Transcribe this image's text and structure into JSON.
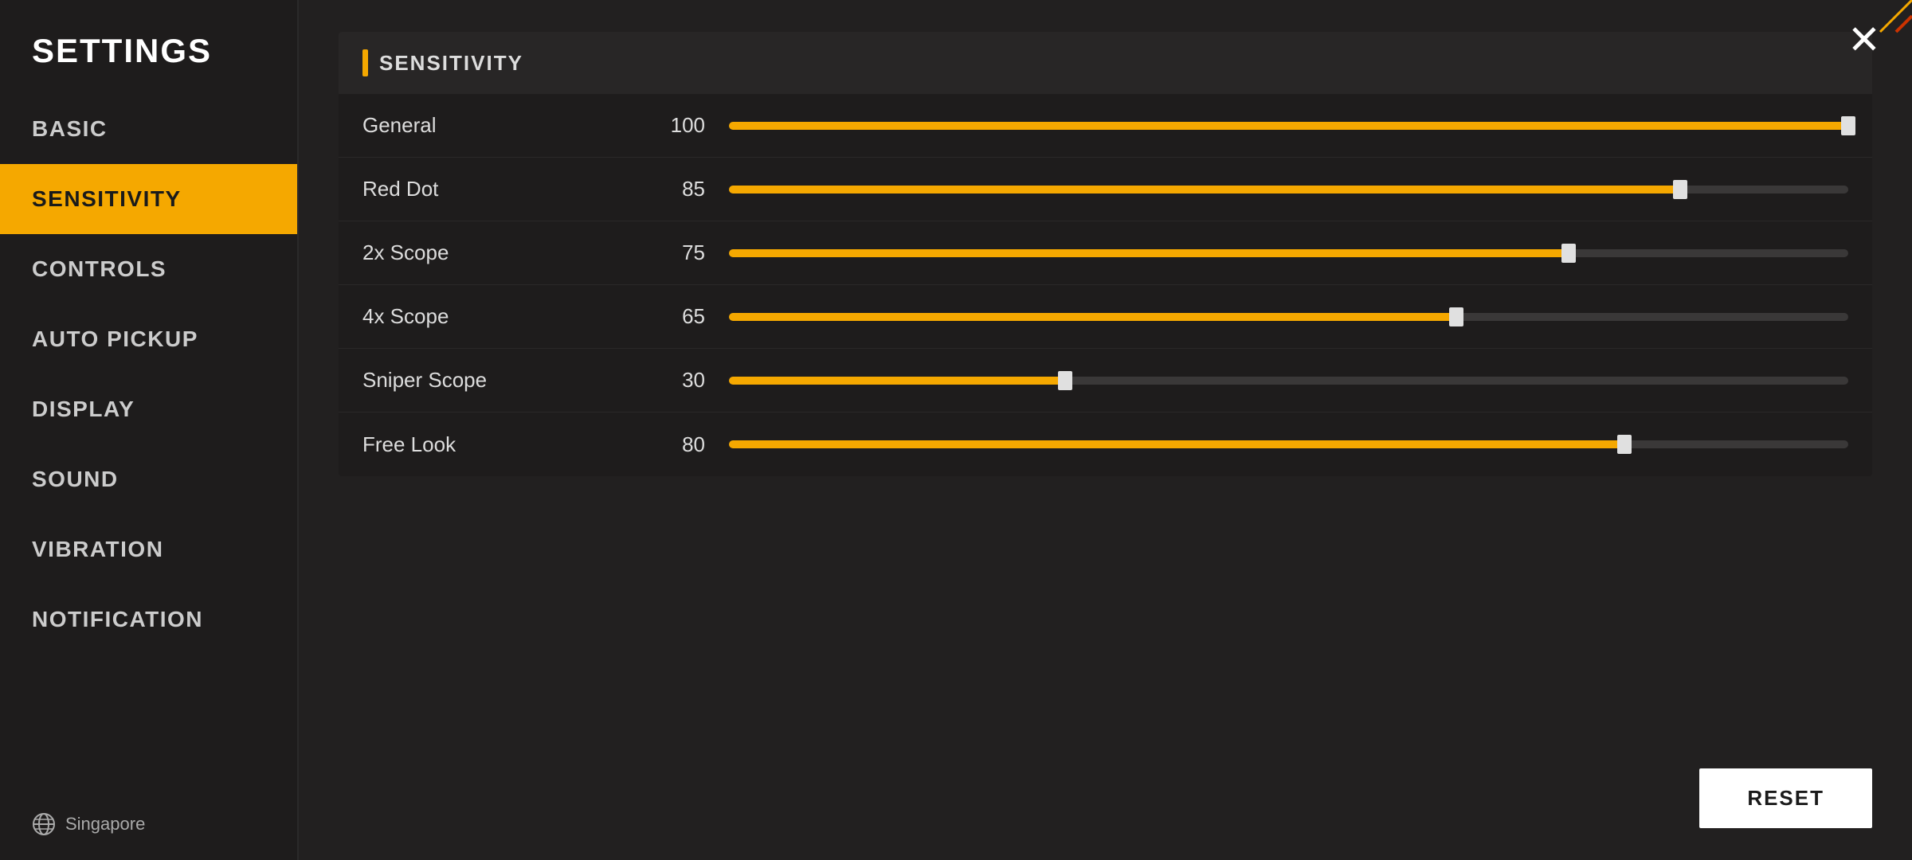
{
  "sidebar": {
    "title": "SETTINGS",
    "nav_items": [
      {
        "id": "basic",
        "label": "BASIC",
        "active": false
      },
      {
        "id": "sensitivity",
        "label": "SENSITIVITY",
        "active": true
      },
      {
        "id": "controls",
        "label": "CONTROLS",
        "active": false
      },
      {
        "id": "auto_pickup",
        "label": "AUTO PICKUP",
        "active": false
      },
      {
        "id": "display",
        "label": "DISPLAY",
        "active": false
      },
      {
        "id": "sound",
        "label": "SOUND",
        "active": false
      },
      {
        "id": "vibration",
        "label": "VIBRATION",
        "active": false
      },
      {
        "id": "notification",
        "label": "NOTIFICATION",
        "active": false
      }
    ],
    "footer": {
      "region": "Singapore"
    }
  },
  "main": {
    "section_title": "SENSITIVITY",
    "sliders": [
      {
        "id": "general",
        "label": "General",
        "value": 100,
        "percent": 100
      },
      {
        "id": "red_dot",
        "label": "Red Dot",
        "value": 85,
        "percent": 85
      },
      {
        "id": "scope_2x",
        "label": "2x Scope",
        "value": 75,
        "percent": 75
      },
      {
        "id": "scope_4x",
        "label": "4x Scope",
        "value": 65,
        "percent": 65
      },
      {
        "id": "sniper_scope",
        "label": "Sniper Scope",
        "value": 30,
        "percent": 30
      },
      {
        "id": "free_look",
        "label": "Free Look",
        "value": 80,
        "percent": 80
      }
    ],
    "reset_button": "RESET"
  },
  "colors": {
    "accent": "#f5a800",
    "sidebar_bg": "#1e1c1c",
    "main_bg": "#222020",
    "active_nav": "#f5a800"
  }
}
